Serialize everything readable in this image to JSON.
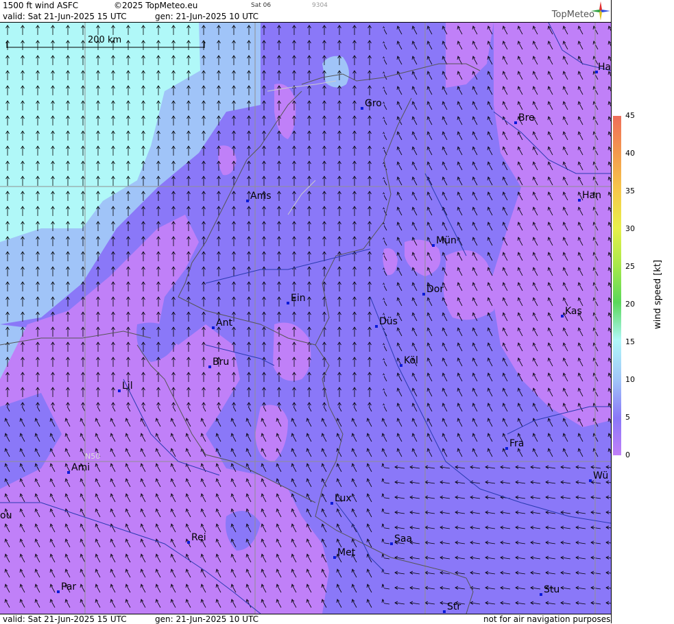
{
  "header": {
    "product": "1500 ft wind ASFC",
    "copyright": "©2025 TopMeteo.eu",
    "day_code": "Sat 06",
    "tile_code": "9304",
    "valid": "valid:  Sat  21-Jun-2025  15 UTC",
    "generated": "gen: 21-Jun-2025 10 UTC",
    "logo": "TopMeteo"
  },
  "footer": {
    "valid": "valid:  Sat  21-Jun-2025  15 UTC",
    "generated": "gen: 21-Jun-2025 10 UTC",
    "disclaimer": "not for air navigation purposes"
  },
  "scale_bar": {
    "label": "200 km"
  },
  "graticule": {
    "lat_label": "N50"
  },
  "legend": {
    "title": "wind speed [kt]",
    "ticks": [
      "45",
      "40",
      "35",
      "30",
      "25",
      "20",
      "15",
      "10",
      "5",
      "0"
    ],
    "colors": [
      "#ee6e5a",
      "#f39a4e",
      "#f6c84a",
      "#e8f04a",
      "#a8e84a",
      "#5ad85a",
      "#b0f8f8",
      "#a0c4f8",
      "#8a78f8",
      "#c080f8"
    ]
  },
  "cities": [
    {
      "name": "Ha"
    },
    {
      "name": "Gro"
    },
    {
      "name": "Bre"
    },
    {
      "name": "Ams"
    },
    {
      "name": "Han"
    },
    {
      "name": "Mün"
    },
    {
      "name": "Ein"
    },
    {
      "name": "Dor"
    },
    {
      "name": "Ant"
    },
    {
      "name": "Düs"
    },
    {
      "name": "Kas"
    },
    {
      "name": "Bru"
    },
    {
      "name": "Köl"
    },
    {
      "name": "Lil"
    },
    {
      "name": "Fra"
    },
    {
      "name": "Ami"
    },
    {
      "name": "Wü"
    },
    {
      "name": "Lux"
    },
    {
      "name": "ou"
    },
    {
      "name": "Rei"
    },
    {
      "name": "Saa"
    },
    {
      "name": "Met"
    },
    {
      "name": "Par"
    },
    {
      "name": "Stu"
    },
    {
      "name": "Str"
    }
  ],
  "colors": {
    "calm": "#c080f8",
    "light": "#8a78f8",
    "moderate": "#a0c4f8",
    "fresh": "#b0f8f8",
    "city_marker": "#0a1ad8"
  }
}
